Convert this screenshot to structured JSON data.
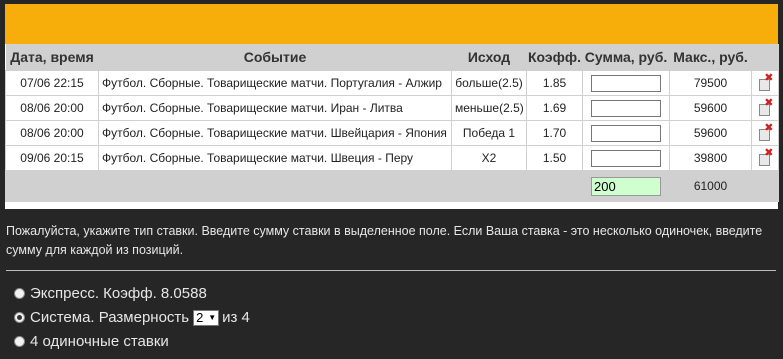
{
  "table": {
    "headers": {
      "date": "Дата, время",
      "event": "Событие",
      "outcome": "Исход",
      "coef": "Коэфф.",
      "sum": "Сумма, руб.",
      "max": "Макс., руб."
    },
    "rows": [
      {
        "date": "07/06 22:15",
        "event": "Футбол. Сборные. Товарищеские матчи. Португалия - Алжир",
        "outcome": "больше(2.5)",
        "coef": "1.85",
        "amount": "",
        "max": "79500"
      },
      {
        "date": "08/06 20:00",
        "event": "Футбол. Сборные. Товарищеские матчи. Иран - Литва",
        "outcome": "меньше(2.5)",
        "coef": "1.69",
        "amount": "",
        "max": "59600"
      },
      {
        "date": "08/06 20:00",
        "event": "Футбол. Сборные. Товарищеские матчи. Швейцария - Япония",
        "outcome": "Победа 1",
        "coef": "1.70",
        "amount": "",
        "max": "59600"
      },
      {
        "date": "09/06 20:15",
        "event": "Футбол. Сборные. Товарищеские матчи. Швеция - Перу",
        "outcome": "X2",
        "coef": "1.50",
        "amount": "",
        "max": "39800"
      }
    ],
    "total": {
      "amount": "200",
      "max": "61000"
    },
    "delete_icon": "delete-icon",
    "delete_color": "#d12020"
  },
  "notice": "Пожалуйста, укажите тип ставки. Введите сумму ставки в выделенное поле. Если Ваша ставка - это несколько одиночек, введите сумму для каждой из позиций.",
  "bet_types": {
    "express": {
      "label": "Экспресс. Коэфф. 8.0588",
      "selected": false
    },
    "system": {
      "label_before": "Система. Размерность",
      "size_value": "2",
      "label_after": "из 4",
      "selected": true
    },
    "singles": {
      "label": "4 одиночные ставки",
      "selected": false
    }
  },
  "colors": {
    "banner": "#f7ae0b",
    "background": "#262626",
    "header_bg": "#d0d0d0",
    "total_field_bg": "#cfffcf"
  }
}
